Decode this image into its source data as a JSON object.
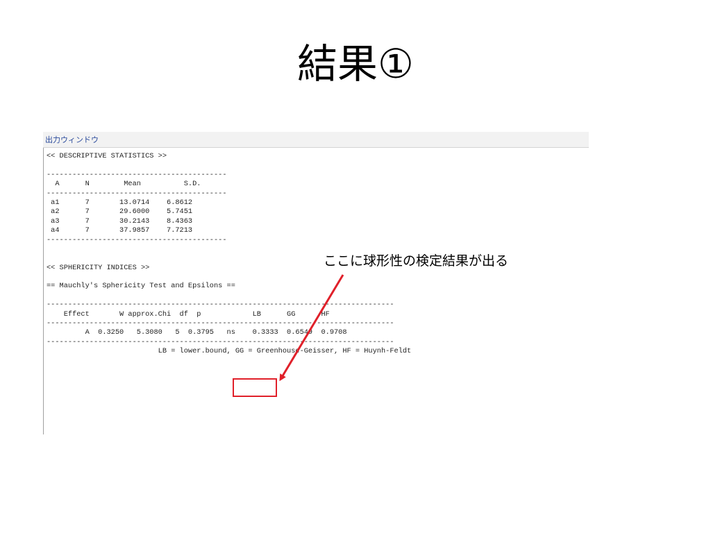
{
  "slide": {
    "title": "結果①"
  },
  "window": {
    "title": "出力ウィンドウ"
  },
  "output_lines": [
    "<< DESCRIPTIVE STATISTICS >>",
    "",
    "------------------------------------------",
    "  A      N        Mean          S.D.",
    "------------------------------------------",
    " a1      7       13.0714    6.8612",
    " a2      7       29.6000    5.7451",
    " a3      7       30.2143    8.4363",
    " a4      7       37.9857    7.7213",
    "------------------------------------------",
    "",
    "",
    "<< SPHERICITY INDICES >>",
    "",
    "== Mauchly's Sphericity Test and Epsilons ==",
    "",
    "---------------------------------------------------------------------------------",
    "    Effect       W approx.Chi  df  p            LB      GG      HF",
    "---------------------------------------------------------------------------------",
    "         A  0.3250   5.3080   5  0.3795   ns    0.3333  0.6549  0.9708",
    "---------------------------------------------------------------------------------",
    "                          LB = lower.bound, GG = Greenhouse-Geisser, HF = Huynh-Feldt"
  ],
  "annotation": {
    "callout": "ここに球形性の検定結果が出る",
    "highlight_color": "#e0202a",
    "arrow_color": "#e0202a"
  }
}
